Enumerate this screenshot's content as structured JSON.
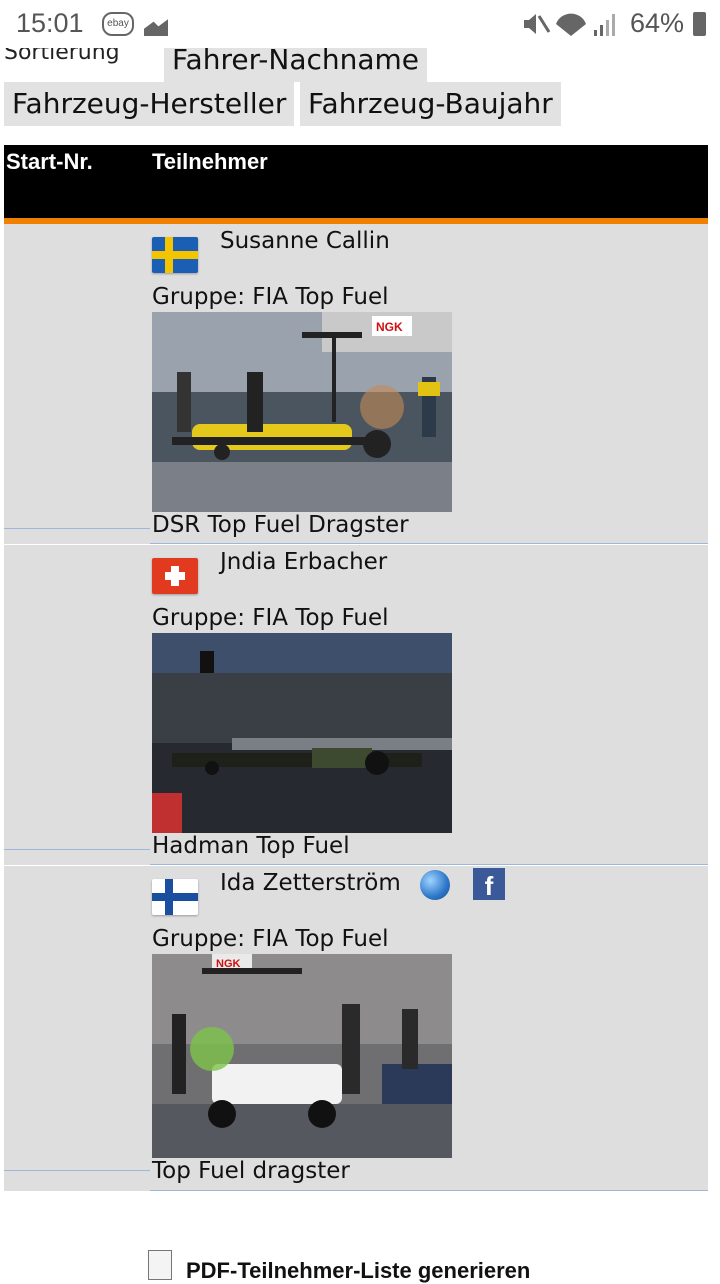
{
  "status_bar": {
    "time": "15:01",
    "notification_icon": "ebay-icon",
    "battery": "64%"
  },
  "sort": {
    "label": "Sortierung",
    "options": [
      "Fahrer-Nachname",
      "Fahrzeug-Hersteller",
      "Fahrzeug-Baujahr"
    ]
  },
  "table": {
    "headers": {
      "start_nr": "Start-Nr.",
      "teilnehmer": "Teilnehmer"
    },
    "entries": [
      {
        "start_nr": "",
        "name": "Susanne Callin",
        "flag": "sweden-flag-icon",
        "group": "Gruppe: FIA Top Fuel",
        "vehicle": "DSR Top Fuel Dragster"
      },
      {
        "start_nr": "",
        "name": "Jndia Erbacher",
        "flag": "switzerland-flag-icon",
        "group": "Gruppe: FIA Top Fuel",
        "vehicle": "Hadman Top Fuel"
      },
      {
        "start_nr": "",
        "name": "Ida Zetterström",
        "flag": "finland-flag-icon",
        "group": "Gruppe: FIA Top Fuel",
        "vehicle": "Top Fuel dragster",
        "links": [
          "globe-icon",
          "facebook-icon"
        ]
      }
    ]
  },
  "footer": {
    "pdf_link": "PDF-Teilnehmer-Liste generieren"
  },
  "colors": {
    "header_bg": "#000000",
    "header_accent": "#f08000",
    "row_bg": "#dedede",
    "divider": "#9cb8d8"
  }
}
